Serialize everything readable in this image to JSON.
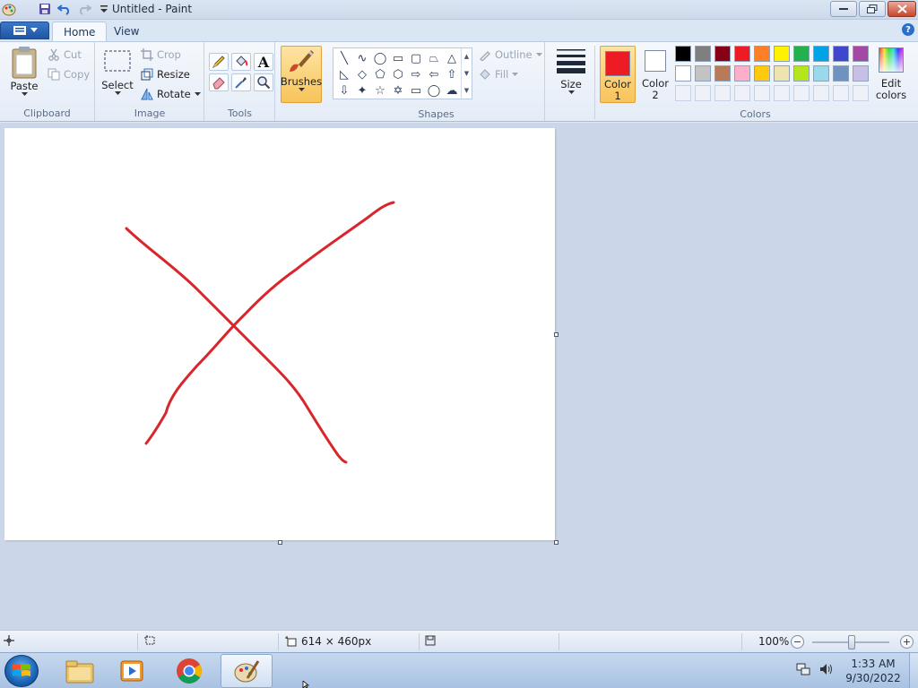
{
  "window": {
    "title": "Untitled - Paint"
  },
  "ribbon": {
    "tabs": [
      {
        "label": "Home"
      },
      {
        "label": "View"
      }
    ],
    "clipboard": {
      "group_label": "Clipboard",
      "paste_label": "Paste",
      "cut_label": "Cut",
      "copy_label": "Copy"
    },
    "image": {
      "group_label": "Image",
      "select_label": "Select",
      "crop_label": "Crop",
      "resize_label": "Resize",
      "rotate_label": "Rotate"
    },
    "tools": {
      "group_label": "Tools",
      "items": [
        "pencil-icon",
        "fill-bucket-icon",
        "text-icon",
        "eraser-icon",
        "color-picker-icon",
        "magnifier-icon"
      ]
    },
    "brushes": {
      "label": "Brushes"
    },
    "shapes": {
      "group_label": "Shapes",
      "outline_label": "Outline",
      "fill_label": "Fill",
      "items": [
        "╲",
        "∿",
        "◯",
        "▭",
        "▢",
        "⏢",
        "△",
        "◺",
        "◇",
        "⬠",
        "⬡",
        "⇨",
        "⇦",
        "⇧",
        "⇩",
        "✦",
        "☆",
        "✡",
        "▭",
        "◯",
        "☁"
      ]
    },
    "size": {
      "label": "Size"
    },
    "colors": {
      "group_label": "Colors",
      "color1_label_1": "Color",
      "color1_label_2": "1",
      "color2_label_1": "Color",
      "color2_label_2": "2",
      "color1_value": "#ed1c24",
      "color2_value": "#ffffff",
      "edit_label_1": "Edit",
      "edit_label_2": "colors",
      "palette_row1": [
        "#000000",
        "#7f7f7f",
        "#880015",
        "#ed1c24",
        "#ff7f27",
        "#fff200",
        "#22b14c",
        "#00a2e8",
        "#3f48cc",
        "#a349a4"
      ],
      "palette_row2": [
        "#ffffff",
        "#c3c3c3",
        "#b97a57",
        "#ffaec9",
        "#ffc90e",
        "#efe4b0",
        "#b5e61d",
        "#99d9ea",
        "#7092be",
        "#c8bfe7"
      ]
    }
  },
  "canvas": {
    "stroke_color": "#d9262c"
  },
  "statusbar": {
    "dimensions": "614 × 460px",
    "zoom": "100%",
    "zoom_level": 0.5
  },
  "taskbar": {
    "time": "1:33 AM",
    "date": "9/30/2022"
  }
}
